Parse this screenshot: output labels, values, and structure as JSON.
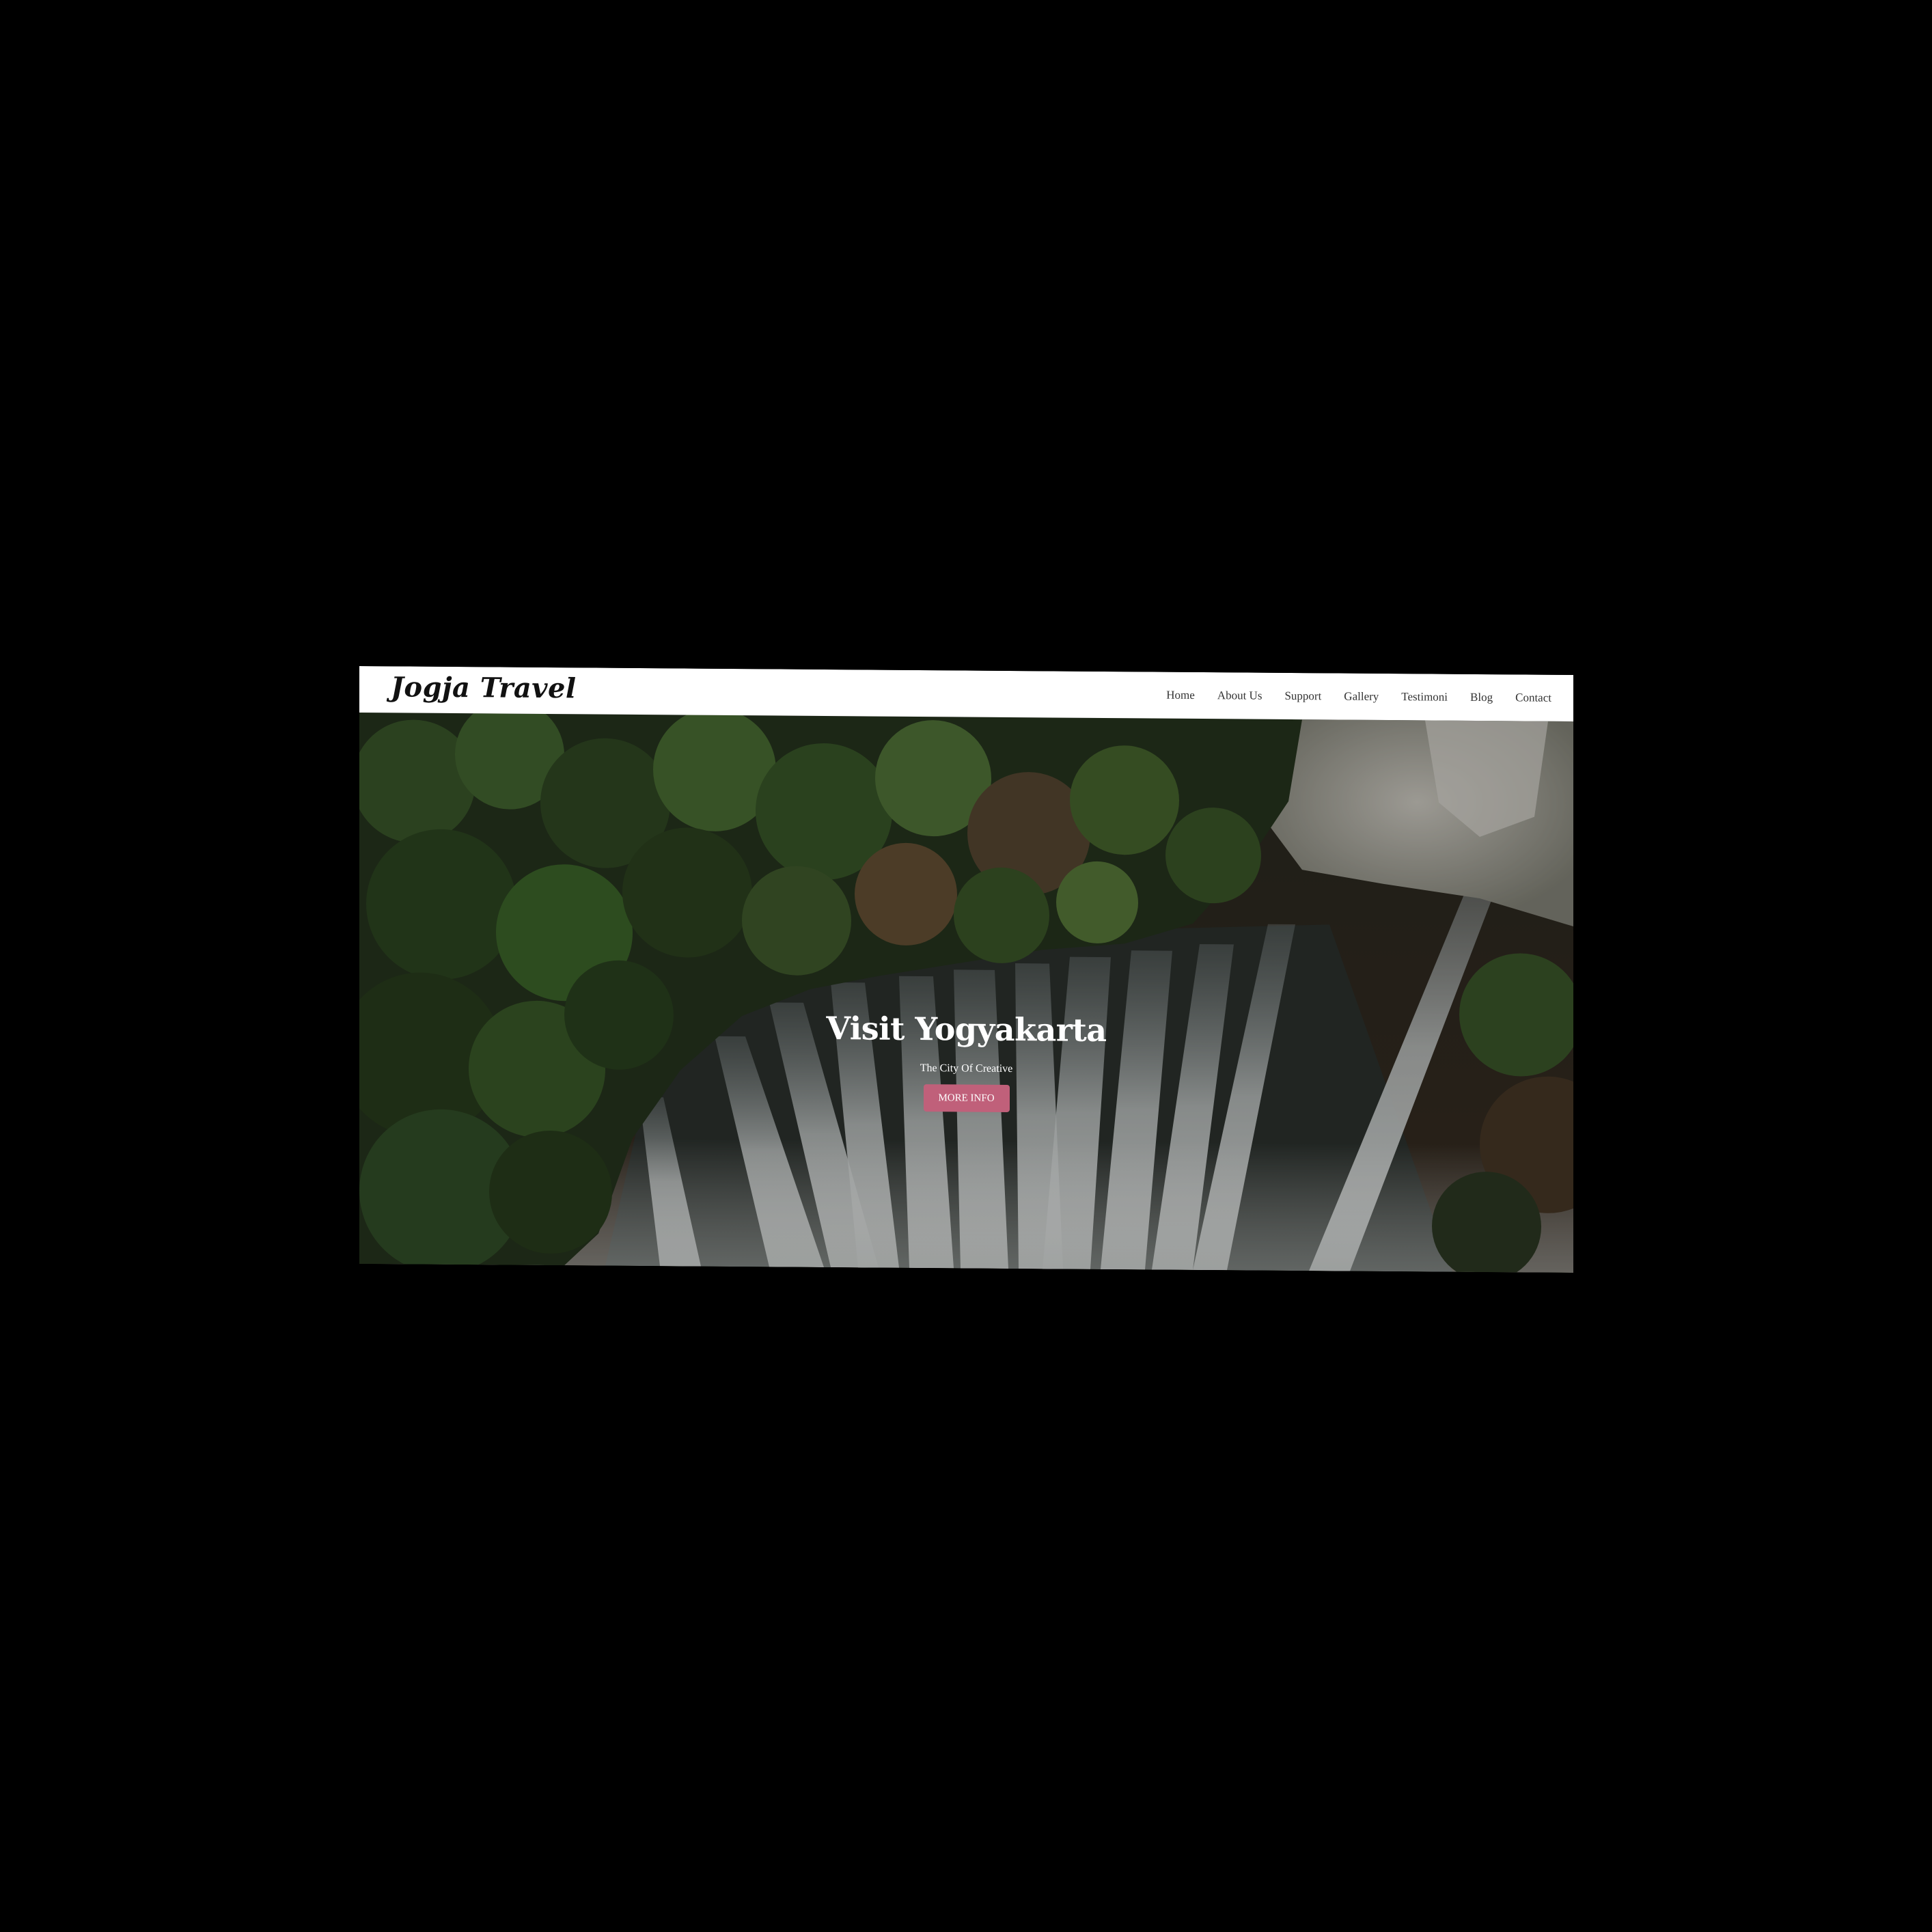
{
  "brand": {
    "name": "Jogja Travel"
  },
  "nav": {
    "items": [
      {
        "label": "Home"
      },
      {
        "label": "About Us"
      },
      {
        "label": "Support"
      },
      {
        "label": "Gallery"
      },
      {
        "label": "Testimoni"
      },
      {
        "label": "Blog"
      },
      {
        "label": "Contact"
      }
    ]
  },
  "hero": {
    "title": "Visit Yogyakarta",
    "subtitle": "The City Of Creative",
    "button_label": "MORE INFO",
    "background_image": "waterfall-forest-photo"
  },
  "colors": {
    "accent": "#c0607a",
    "navbar_bg": "#ffffff",
    "page_bg": "#000000"
  }
}
